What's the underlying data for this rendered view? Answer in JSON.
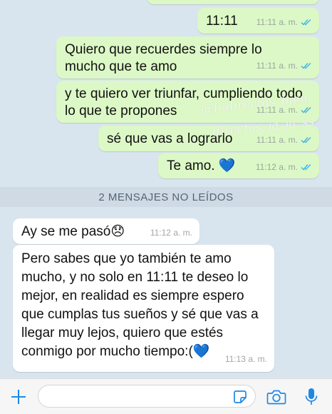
{
  "colors": {
    "outgoing_bubble": "#dcf8c6",
    "incoming_bubble": "#ffffff",
    "background": "#d9e5ee",
    "read_check": "#34b7f1",
    "accent": "#1e88e5"
  },
  "messages": [
    {
      "direction": "outgoing",
      "text": "11:11",
      "time": "11:11 a. m.",
      "status": "read"
    },
    {
      "direction": "outgoing",
      "text": "Quiero que recuerdes siempre lo mucho que te amo",
      "time": "11:11 a. m.",
      "status": "read"
    },
    {
      "direction": "outgoing",
      "text": "y te quiero ver triunfar, cumpliendo todo lo que te propones",
      "time": "11:11 a. m.",
      "status": "read"
    },
    {
      "direction": "outgoing",
      "text": "sé que vas a lograrlo",
      "time": "11:11 a. m.",
      "status": "read"
    },
    {
      "direction": "outgoing",
      "text": "Te amo.",
      "emoji": "blue-heart",
      "time": "11:12 a. m.",
      "status": "read"
    },
    {
      "direction": "incoming",
      "text": "Ay se me pasó",
      "emoji": "disappointed-face",
      "time": "11:12 a. m."
    },
    {
      "direction": "incoming",
      "text": "Pero sabes que yo también te amo mucho, y no solo en 11:11 te deseo lo mejor, en realidad es siempre espero que cumplas tus sueños y sé que vas a llegar muy lejos, quiero que estés conmigo por mucho tiempo:(",
      "emoji": "blue-heart",
      "time": "11:13 a. m."
    }
  ],
  "unread_divider": "2 MENSAJES NO LEÍDOS",
  "watermark": [
    "@Indirectas_bien",
    "directas_ja_ja_ss"
  ],
  "input_bar": {
    "icons": [
      "plus-icon",
      "sticker-icon",
      "camera-icon",
      "microphone-icon"
    ],
    "placeholder": ""
  }
}
